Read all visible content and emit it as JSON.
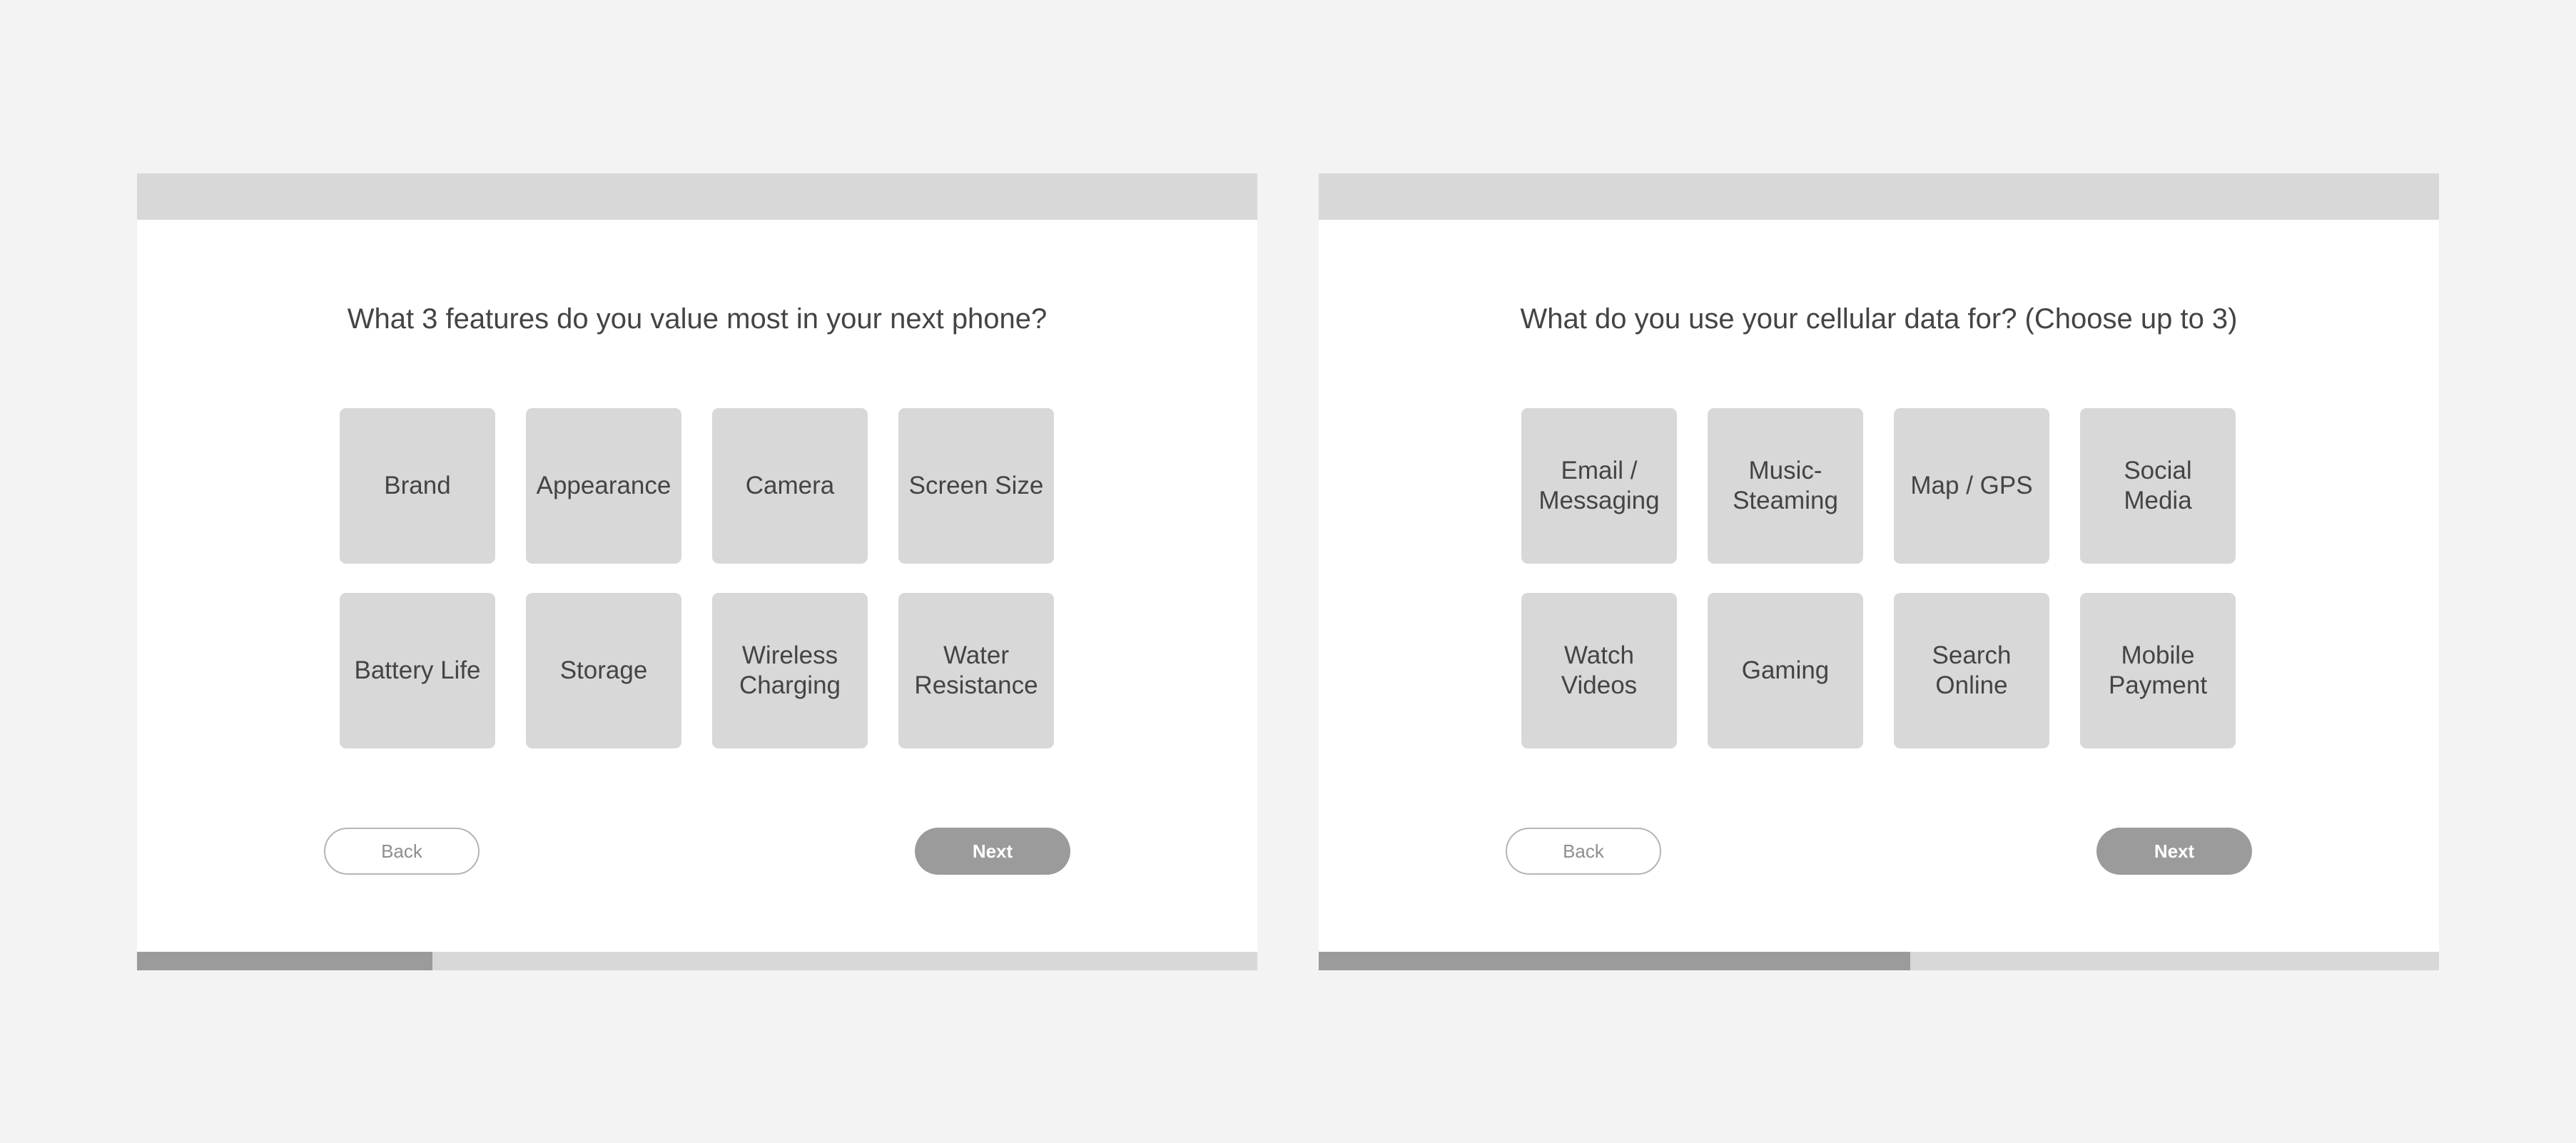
{
  "colors": {
    "background": "#f3f3f3",
    "panel": "#ffffff",
    "tile": "#d8d8d8",
    "accent": "#9b9b9b",
    "text": "#444444"
  },
  "screens": [
    {
      "question": "What 3 features do you value most in your next phone?",
      "options": [
        "Brand",
        "Appearance",
        "Camera",
        "Screen Size",
        "Battery Life",
        "Storage",
        "Wireless\nCharging",
        "Water\nResistance"
      ],
      "back_label": "Back",
      "next_label": "Next",
      "progress": 0.264
    },
    {
      "question": "What do you use your cellular data for? (Choose up to 3)",
      "options": [
        "Email /\nMessaging",
        "Music-\nSteaming",
        "Map / GPS",
        "Social Media",
        "Watch\nVideos",
        "Gaming",
        "Search\nOnline",
        "Mobile\nPayment"
      ],
      "back_label": "Back",
      "next_label": "Next",
      "progress": 0.528
    }
  ]
}
